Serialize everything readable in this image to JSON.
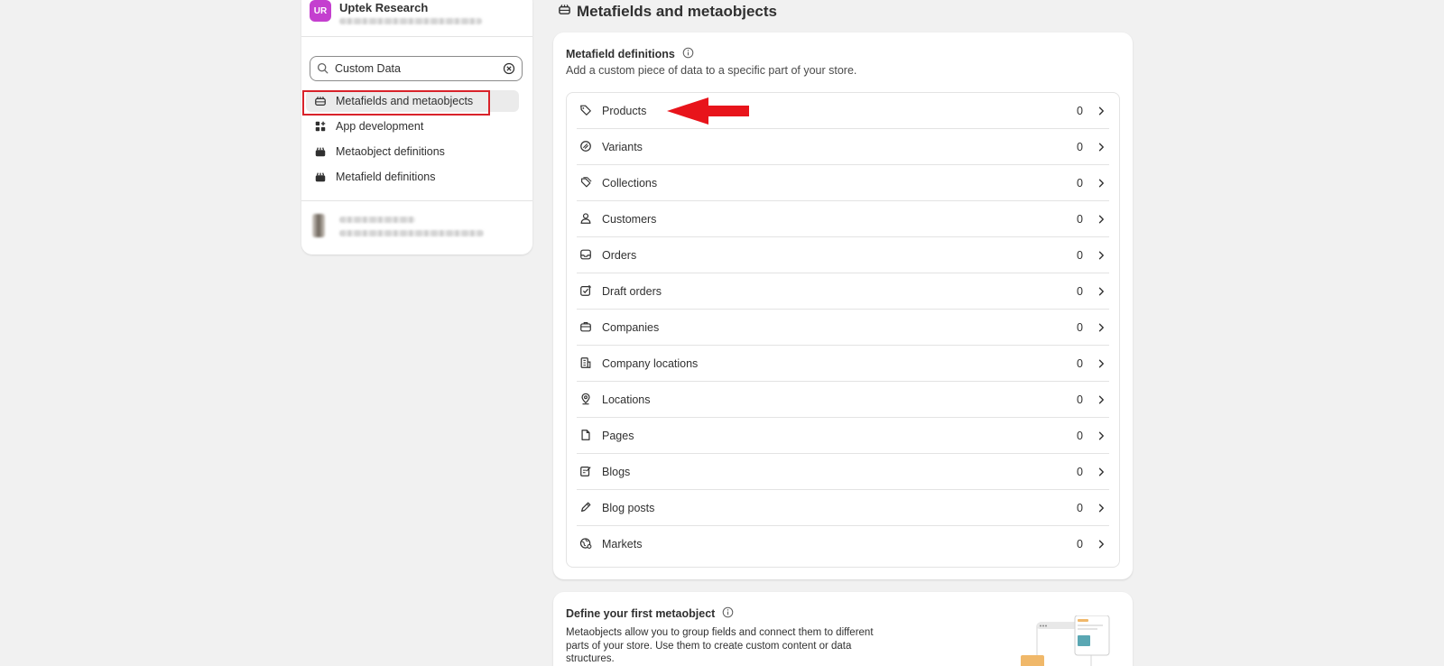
{
  "store": {
    "initials": "UR",
    "name": "Uptek Research",
    "avatar_color": "#c43fcf"
  },
  "search": {
    "value": "Custom Data"
  },
  "menu": {
    "items": [
      {
        "label": "Metafields and metaobjects",
        "icon": "metafields-icon",
        "active": true
      },
      {
        "label": "App development",
        "icon": "apps-icon",
        "active": false
      },
      {
        "label": "Metaobject definitions",
        "icon": "metaobject-icon",
        "active": false
      },
      {
        "label": "Metafield definitions",
        "icon": "metafield-icon",
        "active": false
      }
    ]
  },
  "page": {
    "title": "Metafields and metaobjects"
  },
  "metafield_definitions": {
    "title": "Metafield definitions",
    "subtitle": "Add a custom piece of data to a specific part of your store.",
    "rows": [
      {
        "label": "Products",
        "count": "0",
        "icon": "tag-icon"
      },
      {
        "label": "Variants",
        "count": "0",
        "icon": "variant-icon"
      },
      {
        "label": "Collections",
        "count": "0",
        "icon": "collection-icon"
      },
      {
        "label": "Customers",
        "count": "0",
        "icon": "person-icon"
      },
      {
        "label": "Orders",
        "count": "0",
        "icon": "inbox-icon"
      },
      {
        "label": "Draft orders",
        "count": "0",
        "icon": "draft-order-icon"
      },
      {
        "label": "Companies",
        "count": "0",
        "icon": "briefcase-icon"
      },
      {
        "label": "Company locations",
        "count": "0",
        "icon": "building-icon"
      },
      {
        "label": "Locations",
        "count": "0",
        "icon": "location-pin-icon"
      },
      {
        "label": "Pages",
        "count": "0",
        "icon": "page-icon"
      },
      {
        "label": "Blogs",
        "count": "0",
        "icon": "blog-icon"
      },
      {
        "label": "Blog posts",
        "count": "0",
        "icon": "pencil-icon"
      },
      {
        "label": "Markets",
        "count": "0",
        "icon": "globe-icon"
      }
    ]
  },
  "metaobject_card": {
    "title": "Define your first metaobject",
    "body": "Metaobjects allow you to group fields and connect them to different parts of your store. Use them to create custom content or data structures."
  },
  "colors": {
    "annotation_red": "#d9222a",
    "background": "#f1f1f1"
  }
}
